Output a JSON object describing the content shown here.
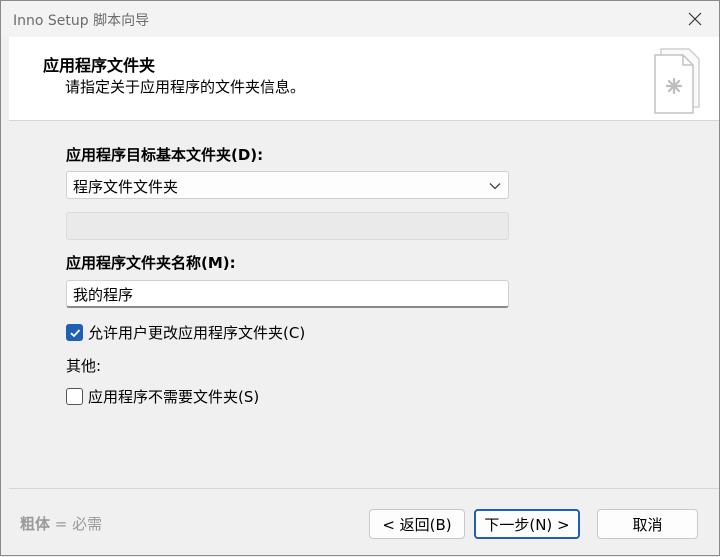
{
  "window": {
    "title": "Inno Setup 脚本向导",
    "close_icon": "close-icon"
  },
  "header": {
    "title": "应用程序文件夹",
    "subtitle": "请指定关于应用程序的文件夹信息。",
    "icon": "document-icon"
  },
  "form": {
    "base_folder_label": "应用程序目标基本文件夹(D):",
    "base_folder_value": "程序文件文件夹",
    "custom_base_folder_value": "",
    "folder_name_label": "应用程序文件夹名称(M):",
    "folder_name_value": "我的程序",
    "allow_change_label": "允许用户更改应用程序文件夹(C)",
    "allow_change_checked": true,
    "other_label": "其他:",
    "no_folder_label": "应用程序不需要文件夹(S)",
    "no_folder_checked": false
  },
  "footer": {
    "legend_bold": "粗体",
    "legend_rest": " = 必需",
    "back_label": "< 返回(B)",
    "next_label": "下一步(N) >",
    "cancel_label": "取消"
  },
  "colors": {
    "accent": "#1f5fb4",
    "header_bg": "#ffffff",
    "window_bg": "#f0f0f0"
  }
}
